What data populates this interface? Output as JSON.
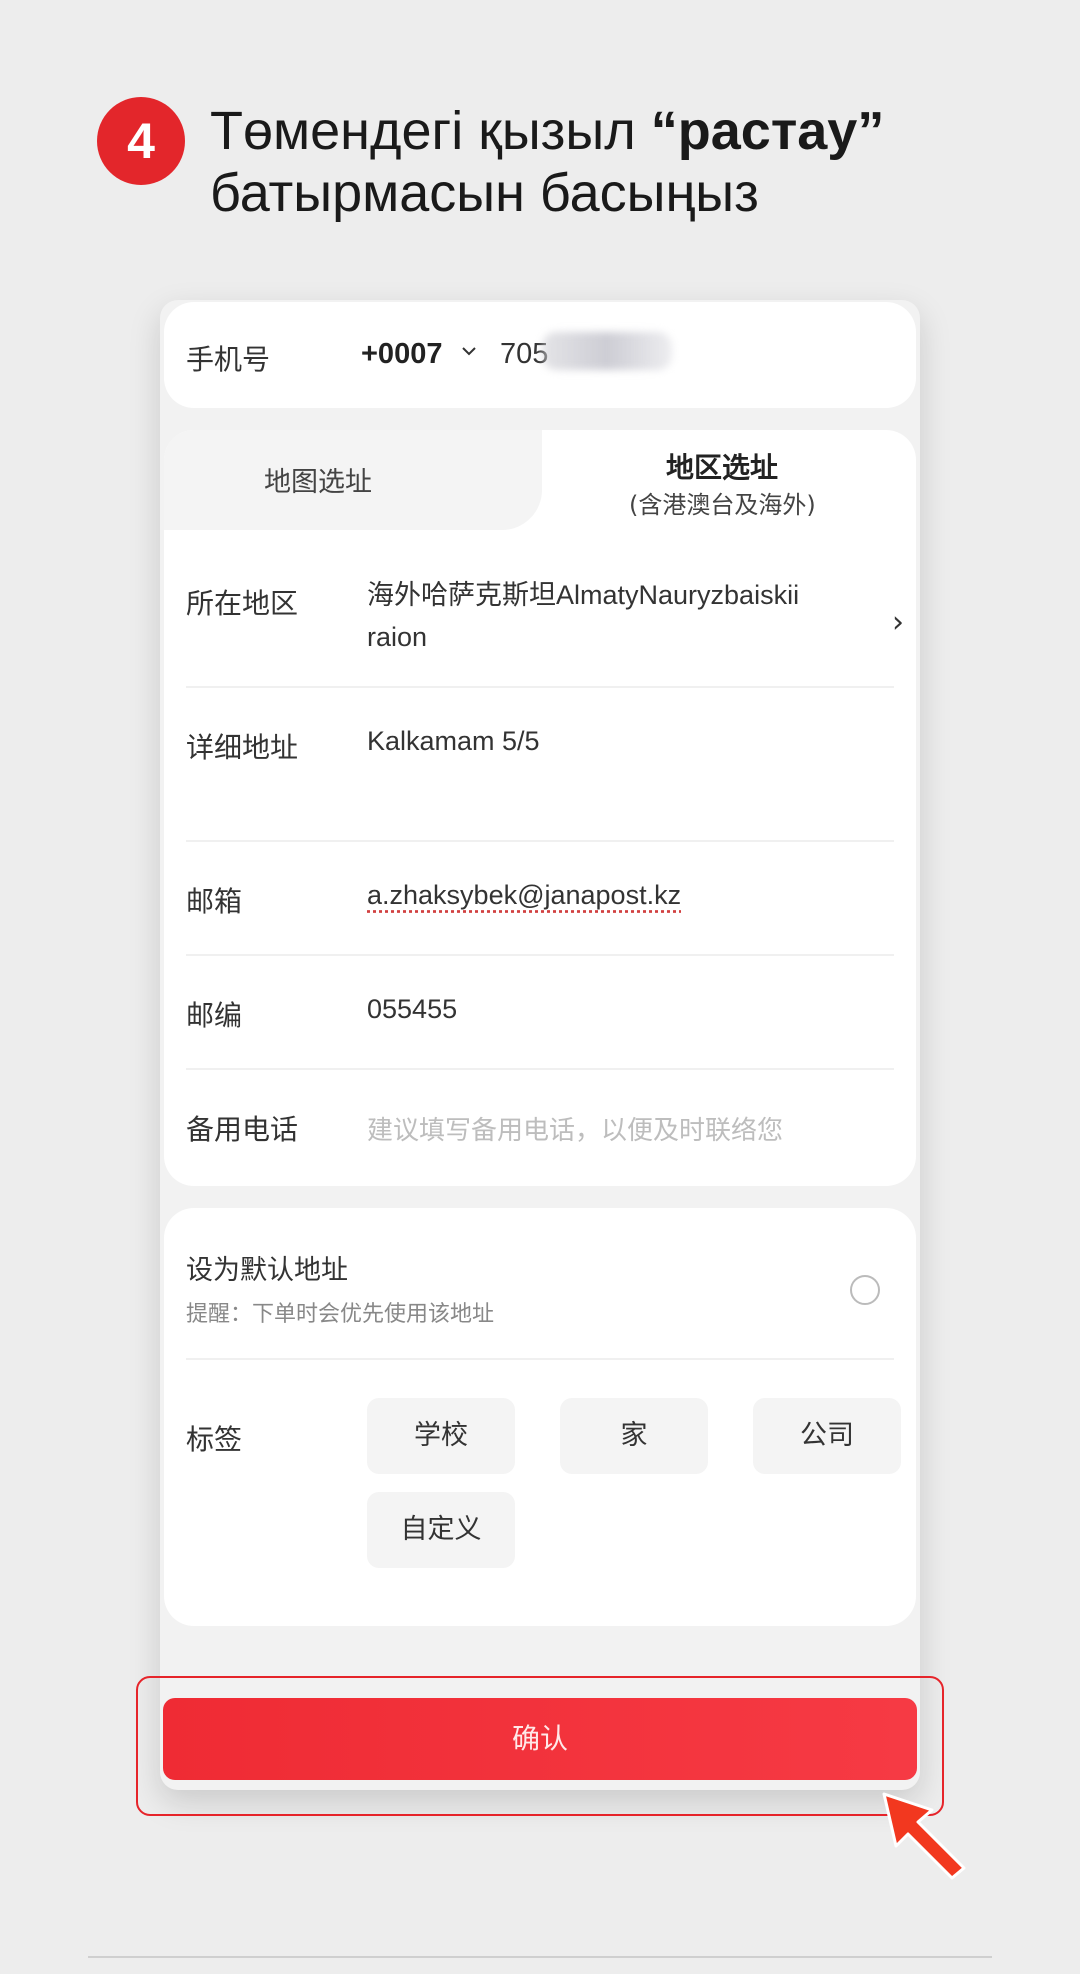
{
  "instruction": {
    "step_number": "4",
    "text_before": "Төмендегі қызыл ",
    "text_bold": "“растау”",
    "text_after": "батырмасын басыңыз"
  },
  "phone_row": {
    "label": "手机号",
    "country_code": "+0007",
    "number_visible": "705"
  },
  "address_tabs": {
    "map_tab": "地图选址",
    "region_tab": "地区选址",
    "region_tab_sub": "(含港澳台及海外)"
  },
  "form": {
    "region_label": "所在地区",
    "region_value": "海外哈萨克斯坦AlmatyNauryzbaiskii raion",
    "detail_label": "详细地址",
    "detail_value": "Kalkamam 5/5",
    "email_label": "邮箱",
    "email_value": "a.zhaksybek@janapost.kz",
    "zip_label": "邮编",
    "zip_value": "055455",
    "backup_phone_label": "备用电话",
    "backup_phone_placeholder": "建议填写备用电话，以便及时联络您"
  },
  "options": {
    "default_title": "设为默认地址",
    "default_hint": "提醒：下单时会优先使用该地址",
    "tags_label": "标签",
    "tags": [
      "学校",
      "家",
      "公司",
      "自定义"
    ]
  },
  "confirm_label": "确认",
  "colors": {
    "accent_red": "#e3262b",
    "button_red": "#f03038"
  }
}
